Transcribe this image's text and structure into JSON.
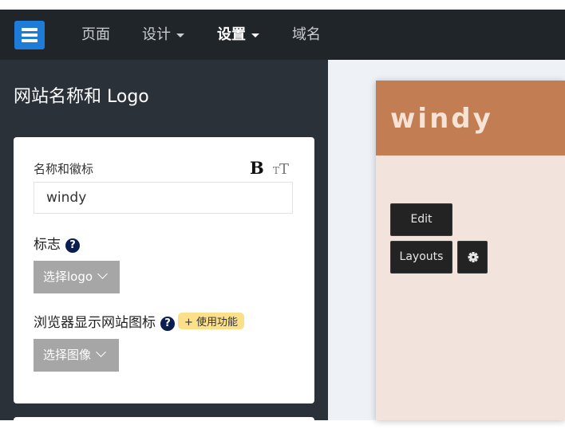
{
  "nav": {
    "items": [
      {
        "label": "页面"
      },
      {
        "label": "设计"
      },
      {
        "label": "设置"
      },
      {
        "label": "域名"
      }
    ]
  },
  "sidebar": {
    "title": "网站名称和 Logo",
    "name_field": {
      "label": "名称和徽标",
      "value": "windy"
    },
    "logo": {
      "label": "标志",
      "button": "选择logo"
    },
    "favicon": {
      "label": "浏览器显示网站图标",
      "badge": "+ 使用功能",
      "button": "选择图像"
    }
  },
  "preview": {
    "site_title": "windy",
    "edit_label": "Edit",
    "layouts_label": "Layouts"
  },
  "colors": {
    "navbar": "#202529",
    "sidebar": "#2a3138",
    "site_header": "#c37d52",
    "site_body": "#f2e4dc",
    "badge": "#fbe089"
  }
}
